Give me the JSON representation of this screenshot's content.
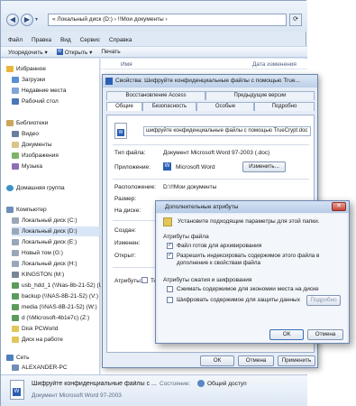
{
  "explorer": {
    "address": "« Локальный диск (D:) › !!Мои документы ›",
    "menu": [
      "Файл",
      "Правка",
      "Вид",
      "Сервис",
      "Справка"
    ],
    "toolbar": {
      "organize": "Упорядочить ▾",
      "open": "Открыть ▾",
      "print": "Печать"
    },
    "columns": {
      "name": "Имя",
      "date": "Дата изменения"
    },
    "nav": {
      "favorites": "Избранное",
      "downloads": "Загрузки",
      "recent": "Недавние места",
      "desktop": "Рабочий стол",
      "libraries": "Библиотеки",
      "video": "Видео",
      "documents": "Документы",
      "images": "Изображения",
      "music": "Музыка",
      "homegroup": "Домашняя группа",
      "computer": "Компьютер",
      "drive_c": "Локальный диск (C:)",
      "drive_d": "Локальный диск (D:)",
      "drive_e": "Локальный диск (E:)",
      "drive_f": "Новый том (G:)",
      "drive_g": "Локальный диск (H:)",
      "kingston": "KINGSTON (M:)",
      "usb": "usb_hdd_1 (\\\\Nas-8b-21-52) (U:)",
      "backup": "backup (\\\\NAS-8B-21-52) (V:)",
      "media": "media (\\\\NAS-8B-21-52) (W:)",
      "d_share": "d (\\\\Microsoft-4b1e7c) (Z:)",
      "disk_pcworld": "Disk PCWorld",
      "work_disk": "Диск на работе",
      "network": "Сеть",
      "alexander": "ALEXANDER-PC",
      "nas": "NAS-8B-21-52"
    },
    "details": {
      "filename": "Шифруйте конфиденциальные файлы с ...",
      "filetype": "Документ Microsoft Word 97-2003",
      "state_label": "Состояние:",
      "state_value": "Общий доступ"
    }
  },
  "properties": {
    "title": "Свойства: Шифруйте конфиденциальные файлы с помощью True...",
    "tabs_row1": [
      "Восстановление Access",
      "Предыдущие версии"
    ],
    "tabs_row2": [
      "Общие",
      "Безопасность",
      "Особые",
      "Подробно"
    ],
    "filename_field": "шифруйте конфиденциальные файлы с помощью TrueCrypt.doc",
    "type_label": "Тип файла:",
    "type_value": "Документ Microsoft Word 97-2003 (.doc)",
    "app_label": "Приложение:",
    "app_value": "Microsoft Word",
    "change_button": "Изменить...",
    "location_label": "Расположение:",
    "location_value": "D:\\!!Мои документы",
    "size_label": "Размер:",
    "disk_label": "На диске:",
    "created_label": "Создан:",
    "modified_label": "Изменен:",
    "opened_label": "Открыт:",
    "attributes_label": "Атрибуты:",
    "readonly_label": "Тол",
    "ok": "ОК",
    "cancel": "Отмена",
    "apply": "Применить"
  },
  "advanced": {
    "title": "Дополнительные атрибуты",
    "close_glyph": "✕",
    "intro": "Установите подходящие параметры для этой папки.",
    "file_attrs_header": "Атрибуты файла",
    "archive_label": "Файл готов для архивирования",
    "index_label": "Разрешить индексировать содержимое этого файла в дополнение к свойствам файла",
    "compress_header": "Атрибуты сжатия и шифрования",
    "compress_label": "Сжимать содержимое для экономии места на диске",
    "encrypt_label": "Шифровать содержимое для защиты данных",
    "details_button": "Подробно",
    "ok": "ОК",
    "cancel": "Отмена",
    "archive_checked": true,
    "index_checked": true,
    "compress_checked": false,
    "encrypt_checked": false
  }
}
